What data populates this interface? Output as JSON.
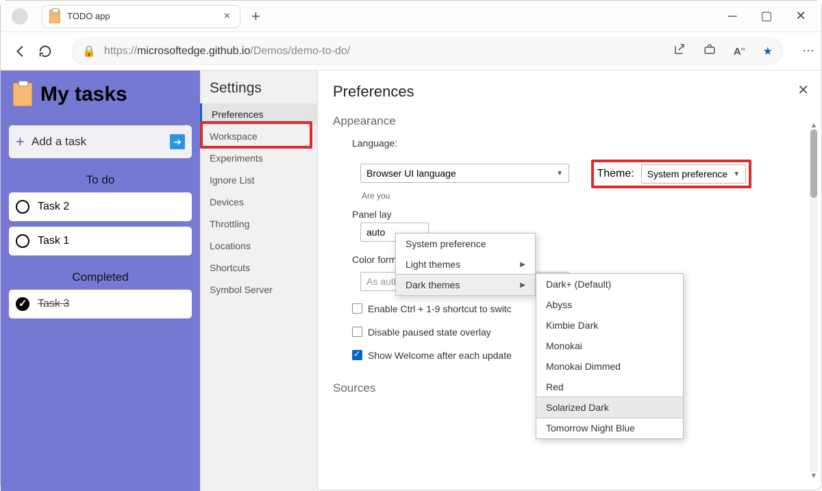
{
  "browser": {
    "tab_title": "TODO app",
    "url_prefix": "https://",
    "url_host": "microsoftedge.github.io",
    "url_path": "/Demos/demo-to-do/"
  },
  "app": {
    "title": "My tasks",
    "add_placeholder": "Add a task",
    "sections": {
      "todo_label": "To do",
      "completed_label": "Completed"
    },
    "todo_tasks": [
      "Task 2",
      "Task 1"
    ],
    "completed_tasks": [
      "Task 3"
    ]
  },
  "settings": {
    "heading": "Settings",
    "items": [
      "Preferences",
      "Workspace",
      "Experiments",
      "Ignore List",
      "Devices",
      "Throttling",
      "Locations",
      "Shortcuts",
      "Symbol Server"
    ],
    "active_index": 0
  },
  "prefs": {
    "title": "Preferences",
    "group_appearance": "Appearance",
    "group_sources": "Sources",
    "language_label": "Language:",
    "language_value": "Browser UI language",
    "theme_label": "Theme:",
    "theme_value": "System preference",
    "question_hint": "Are you",
    "panel_layout_label": "Panel lay",
    "panel_layout_value": "auto",
    "color_format_label": "Color format:",
    "color_format_value": "As authored",
    "checkbox1": "Enable Ctrl + 1-9 shortcut to switc",
    "checkbox2": "Disable paused state overlay",
    "checkbox3": "Show Welcome after each update"
  },
  "menu1": {
    "items": [
      "System preference",
      "Light themes",
      "Dark themes"
    ],
    "submenu_flags": [
      false,
      true,
      true
    ],
    "hover_index": 2
  },
  "menu2": {
    "items": [
      "Dark+ (Default)",
      "Abyss",
      "Kimbie Dark",
      "Monokai",
      "Monokai Dimmed",
      "Red",
      "Solarized Dark",
      "Tomorrow Night Blue"
    ],
    "hover_index": 6
  }
}
